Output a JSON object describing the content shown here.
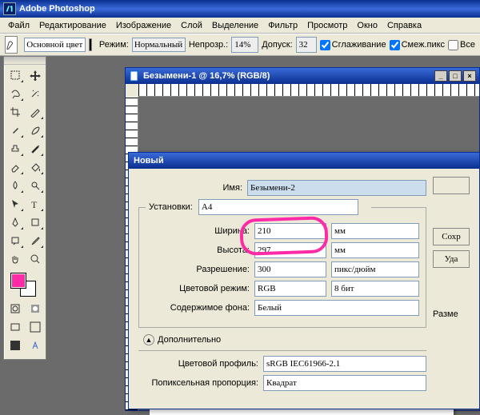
{
  "app": {
    "title": "Adobe Photoshop"
  },
  "menu": {
    "file": "Файл",
    "edit": "Редактирование",
    "image": "Изображение",
    "layer": "Слой",
    "select": "Выделение",
    "filter": "Фильтр",
    "view": "Просмотр",
    "window": "Окно",
    "help": "Справка"
  },
  "options": {
    "swatch_label": "Основной цвет",
    "mode_label": "Режим:",
    "mode_value": "Нормальный",
    "opacity_label": "Непрозр.:",
    "opacity_value": "14%",
    "tolerance_label": "Допуск:",
    "tolerance_value": "32",
    "antialias": "Сглаживание",
    "contiguous": "Смеж.пикс",
    "all_layers": "Все"
  },
  "document": {
    "title": "Безымени-1 @ 16,7% (RGB/8)"
  },
  "dialog": {
    "title": "Новый",
    "name_label": "Имя:",
    "name_value": "Безымени-2",
    "preset_label": "Установки:",
    "preset_value": "A4",
    "width_label": "Ширина:",
    "width_value": "210",
    "width_unit": "мм",
    "height_label": "Высота:",
    "height_value": "297",
    "height_unit": "мм",
    "res_label": "Разрешение:",
    "res_value": "300",
    "res_unit": "пикс/дюйм",
    "mode_label": "Цветовой режим:",
    "mode_value": "RGB",
    "mode_bits": "8 бит",
    "bgcontents_label": "Содержимое фона:",
    "bgcontents_value": "Белый",
    "advanced": "Дополнительно",
    "profile_label": "Цветовой профиль:",
    "profile_value": "sRGB IEC61966-2.1",
    "pixelaspect_label": "Попиксельная пропорция:",
    "pixelaspect_value": "Квадрат",
    "save_btn": "Сохр",
    "delete_btn": "Уда",
    "size_label": "Разме"
  },
  "colors": {
    "fg": "#ff2ba6",
    "bg": "#ffffff"
  }
}
